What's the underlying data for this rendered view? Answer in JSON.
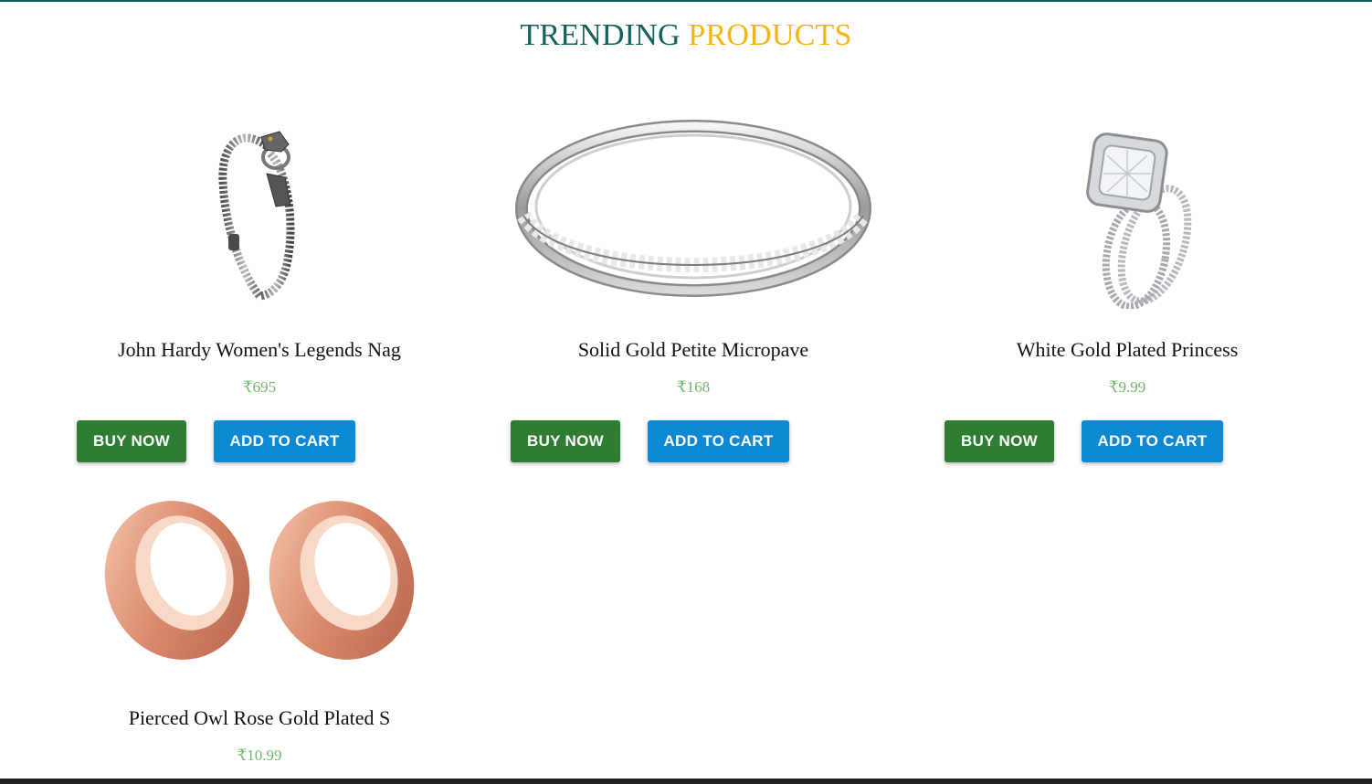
{
  "section": {
    "title_part1": "TRENDING",
    "title_part2": "PRODUCTS"
  },
  "colors": {
    "title_primary": "#14615c",
    "title_accent": "#f5b40f",
    "price": "#6cb86a",
    "buy_button": "#2e7d32",
    "cart_button": "#0d88d3"
  },
  "buttons": {
    "buy_label": "BUY NOW",
    "cart_label": "ADD TO CART"
  },
  "products": [
    {
      "name": "John Hardy Women's Legends Nag",
      "price": "₹695",
      "image": "silver-chain-bracelet"
    },
    {
      "name": "Solid Gold Petite Micropave",
      "price": "₹168",
      "image": "silver-band-ring"
    },
    {
      "name": "White Gold Plated Princess",
      "price": "₹9.99",
      "image": "diamond-ring-set"
    },
    {
      "name": "Pierced Owl Rose Gold Plated S",
      "price": "₹10.99",
      "image": "rose-gold-plugs"
    }
  ]
}
